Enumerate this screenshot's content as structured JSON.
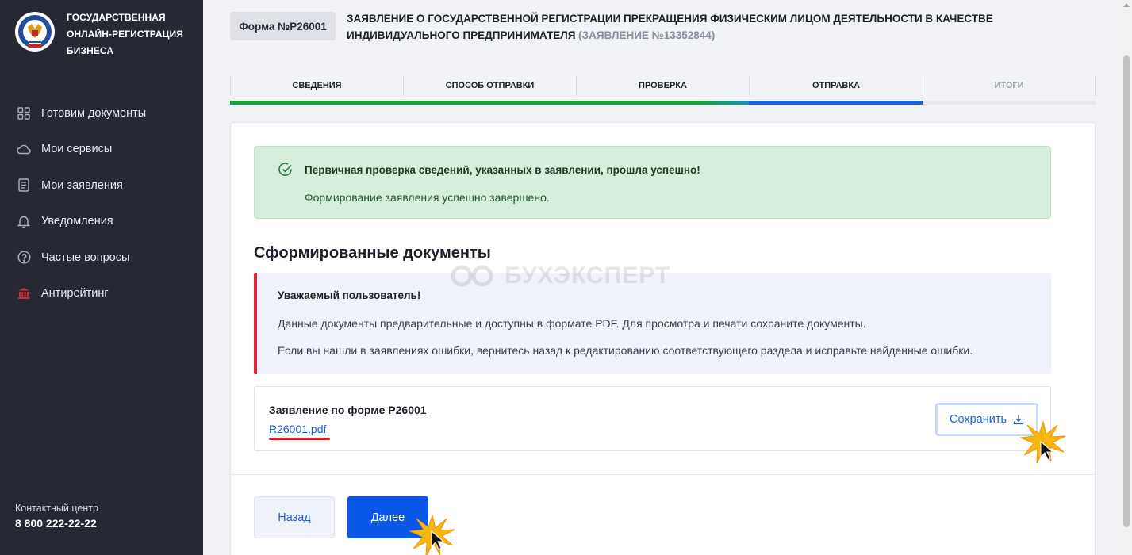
{
  "sidebar": {
    "brand_lines": [
      "ГОСУДАРСТВЕННАЯ",
      "ОНЛАЙН-РЕГИСТРАЦИЯ",
      "БИЗНЕСА"
    ],
    "items": [
      {
        "label": "Готовим документы",
        "icon": "grid-icon"
      },
      {
        "label": "Мои сервисы",
        "icon": "cloud-icon"
      },
      {
        "label": "Мои заявления",
        "icon": "document-icon"
      },
      {
        "label": "Уведомления",
        "icon": "bell-icon"
      },
      {
        "label": "Частые вопросы",
        "icon": "question-icon"
      },
      {
        "label": "Антирейтинг",
        "icon": "bank-icon"
      }
    ],
    "contact_label": "Контактный центр",
    "contact_phone": "8 800 222-22-22"
  },
  "header": {
    "form_badge": "Форма №Р26001",
    "title": "ЗАЯВЛЕНИЕ О ГОСУДАРСТВЕННОЙ РЕГИСТРАЦИИ ПРЕКРАЩЕНИЯ ФИЗИЧЕСКИМ ЛИЦОМ ДЕЯТЕЛЬНОСТИ В КАЧЕСТВЕ ИНДИВИДУАЛЬНОГО ПРЕДПРИНИМАТЕЛЯ",
    "app_number": "(ЗАЯВЛЕНИЕ №13352844)"
  },
  "steps": [
    {
      "label": "СВЕДЕНИЯ",
      "state": "done"
    },
    {
      "label": "СПОСОБ ОТПРАВКИ",
      "state": "done"
    },
    {
      "label": "ПРОВЕРКА",
      "state": "done"
    },
    {
      "label": "ОТПРАВКА",
      "state": "active"
    },
    {
      "label": "ИТОГИ",
      "state": "pending"
    }
  ],
  "success": {
    "title": "Первичная проверка сведений, указанных в заявлении, прошла успешно!",
    "text": "Формирование заявления успешно завершено."
  },
  "documents": {
    "title": "Сформированные документы",
    "notice_title": "Уважаемый пользователь!",
    "notice_line1": "Данные документы предварительные и доступны в формате PDF. Для просмотра и печати сохраните документы.",
    "notice_line2": "Если вы нашли в заявлениях ошибки, вернитесь назад к редактированию соответствующего раздела и исправьте найденные ошибки.",
    "doc_name": "Заявление по форме Р26001",
    "doc_file": "R26001.pdf",
    "save_label": "Сохранить"
  },
  "watermark": "БУХЭКСПЕРТ",
  "buttons": {
    "back": "Назад",
    "next": "Далее"
  },
  "colors": {
    "sidebar_bg": "#262833",
    "accent_blue": "#0b57e8",
    "progress_done": "#16a23a",
    "progress_active": "#1a5fe3",
    "success_bg": "#d6eedb",
    "notice_border": "#e32636"
  }
}
